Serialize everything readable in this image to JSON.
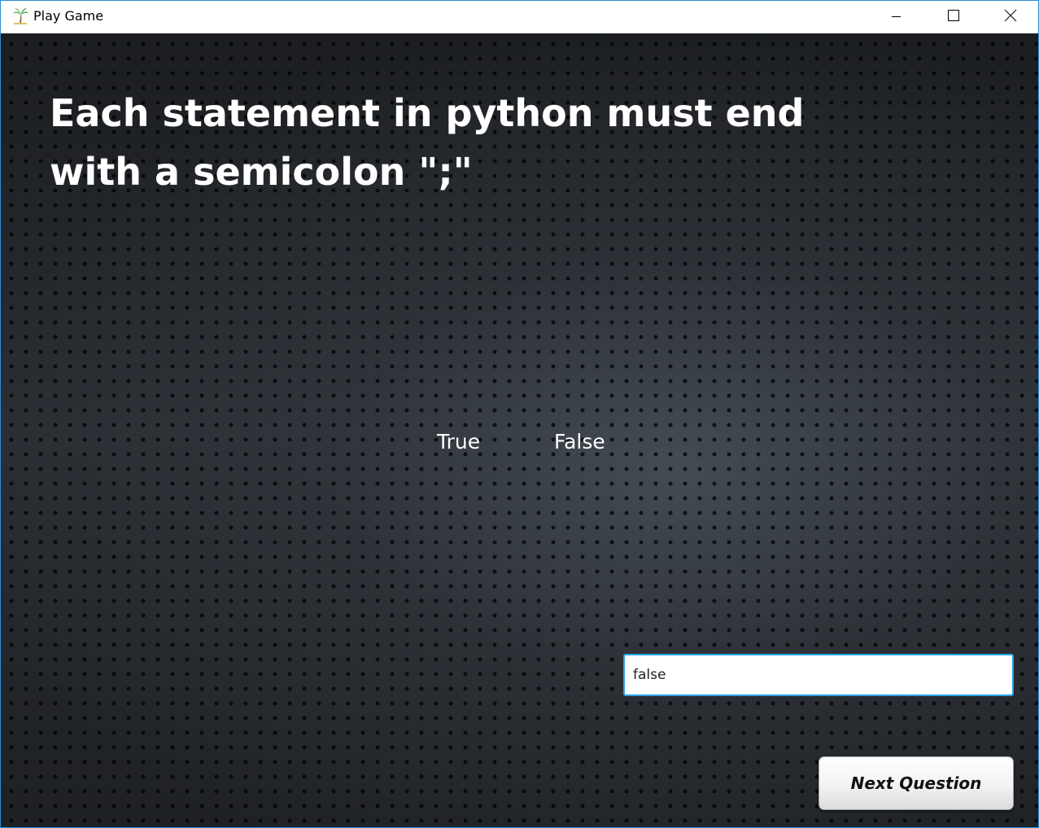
{
  "window": {
    "title": "Play Game",
    "app_icon": "palm-tree-icon",
    "controls": [
      "minimize-icon",
      "maximize-icon",
      "close-icon"
    ]
  },
  "game": {
    "question": "Each statement in python must end with a semicolon \";\"",
    "options": [
      "True",
      "False"
    ],
    "answer_value": "false",
    "next_button_label": "Next Question"
  },
  "colors": {
    "background": "#24272b",
    "question_text": "#ffffff",
    "input_focus_border": "#27a2e6",
    "window_border": "#2b8fd6"
  }
}
